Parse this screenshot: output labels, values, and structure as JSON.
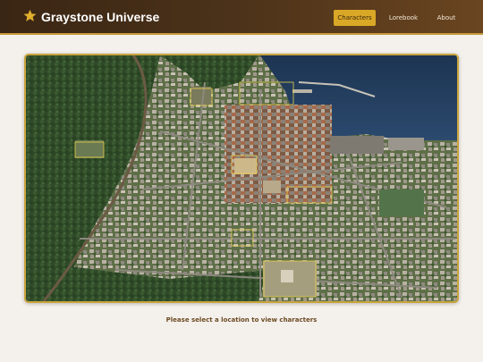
{
  "header": {
    "title": "Graystone Universe",
    "logo_icon": "star-icon",
    "accent_color": "#d9a826",
    "nav": [
      {
        "label": "Characters",
        "active": true
      },
      {
        "label": "Lorebook",
        "active": false
      },
      {
        "label": "About",
        "active": false
      }
    ]
  },
  "map": {
    "image": "aerial-town-photo",
    "location_markers": 7
  },
  "prompt": "Please select a location to view characters"
}
